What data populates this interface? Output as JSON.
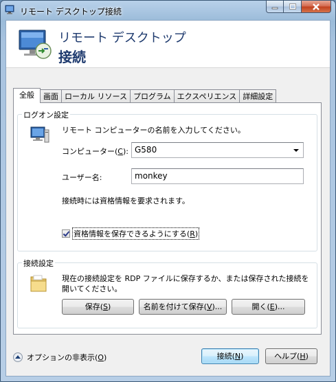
{
  "window": {
    "title": "リモート デスクトップ接続",
    "icon": "remote-desktop-icon"
  },
  "banner": {
    "line1": "リモート デスクトップ",
    "line2": "接続"
  },
  "tabs": [
    {
      "label": "全般",
      "active": true
    },
    {
      "label": "画面",
      "active": false
    },
    {
      "label": "ローカル リソース",
      "active": false
    },
    {
      "label": "プログラム",
      "active": false
    },
    {
      "label": "エクスペリエンス",
      "active": false
    },
    {
      "label": "詳細設定",
      "active": false
    }
  ],
  "logon": {
    "group_label": "ログオン設定",
    "instruction": "リモート コンピューターの名前を入力してください。",
    "computer_label": "コンピューター(",
    "computer_accel": "C",
    "computer_label_end": "):",
    "computer_value": "G580",
    "user_label": "ユーザー名:",
    "user_value": "monkey",
    "credentials_note": "接続時には資格情報を要求されます。",
    "save_credentials_label": "資格情報を保存できるようにする(",
    "save_credentials_accel": "R",
    "save_credentials_end": ")",
    "save_credentials_checked": true
  },
  "connection": {
    "group_label": "接続設定",
    "description_line1": "現在の接続設定を RDP ファイルに保存するか、または保存された接続を",
    "description_line2": "開いてください。",
    "save_label": "保存(",
    "save_accel": "S",
    "save_end": ")",
    "save_as_label": "名前を付けて保存(",
    "save_as_accel": "V",
    "save_as_end": ")...",
    "open_label": "開く(",
    "open_accel": "E",
    "open_end": ")..."
  },
  "footer": {
    "options_label": "オプションの非表示(",
    "options_accel": "O",
    "options_end": ")",
    "connect_label": "接続(",
    "connect_accel": "N",
    "connect_end": ")",
    "help_label": "ヘルプ(",
    "help_accel": "H",
    "help_end": ")"
  },
  "colors": {
    "banner_text": "#1e3a6e",
    "close_button": "#c1401d"
  }
}
